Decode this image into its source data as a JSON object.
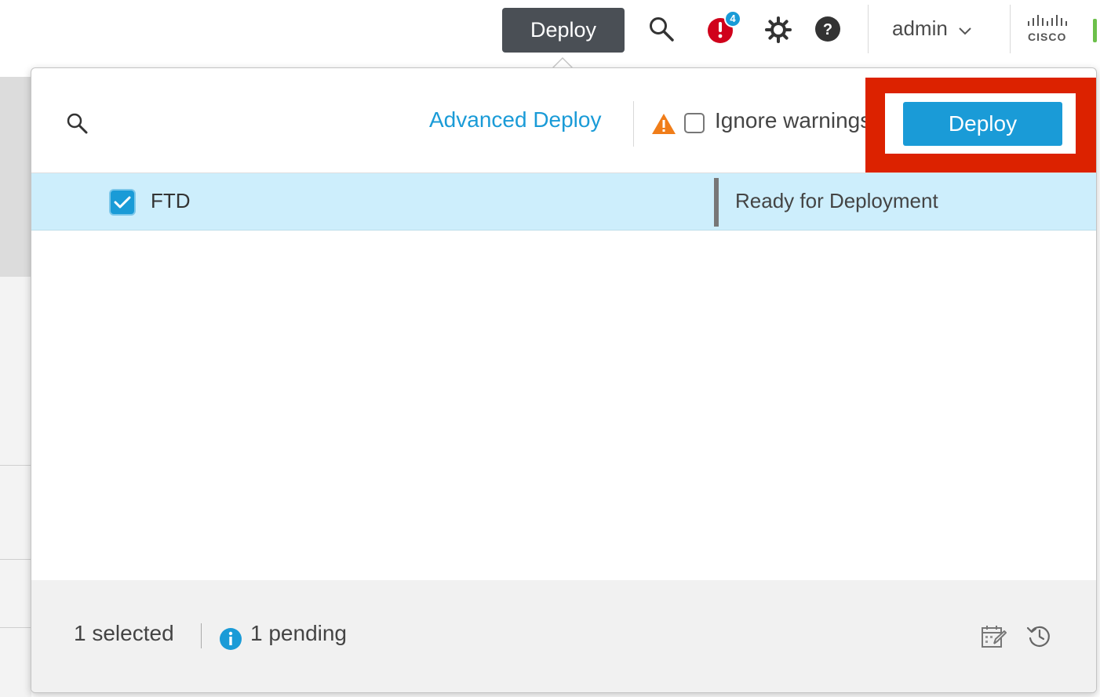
{
  "topbar": {
    "deploy_label": "Deploy",
    "notification_count": "4",
    "user_label": "admin",
    "logo_text": "CISCO"
  },
  "panel": {
    "advanced_deploy_label": "Advanced Deploy",
    "ignore_warnings_label": "Ignore warnings",
    "deploy_label": "Deploy"
  },
  "devices": [
    {
      "name": "FTD",
      "status": "Ready for Deployment",
      "checked": true
    }
  ],
  "footer": {
    "selected_text": "1 selected",
    "pending_text": "1 pending"
  },
  "colors": {
    "accent": "#1a9bd7",
    "highlight": "#dc2200",
    "selected_row": "#cdeefc",
    "warning": "#f07d19",
    "alert": "#d0021b"
  },
  "icons": [
    "search-icon",
    "alert-icon",
    "gear-icon",
    "help-icon",
    "chevron-down-icon",
    "warning-icon",
    "check-icon",
    "info-icon",
    "schedule-icon",
    "history-icon"
  ]
}
